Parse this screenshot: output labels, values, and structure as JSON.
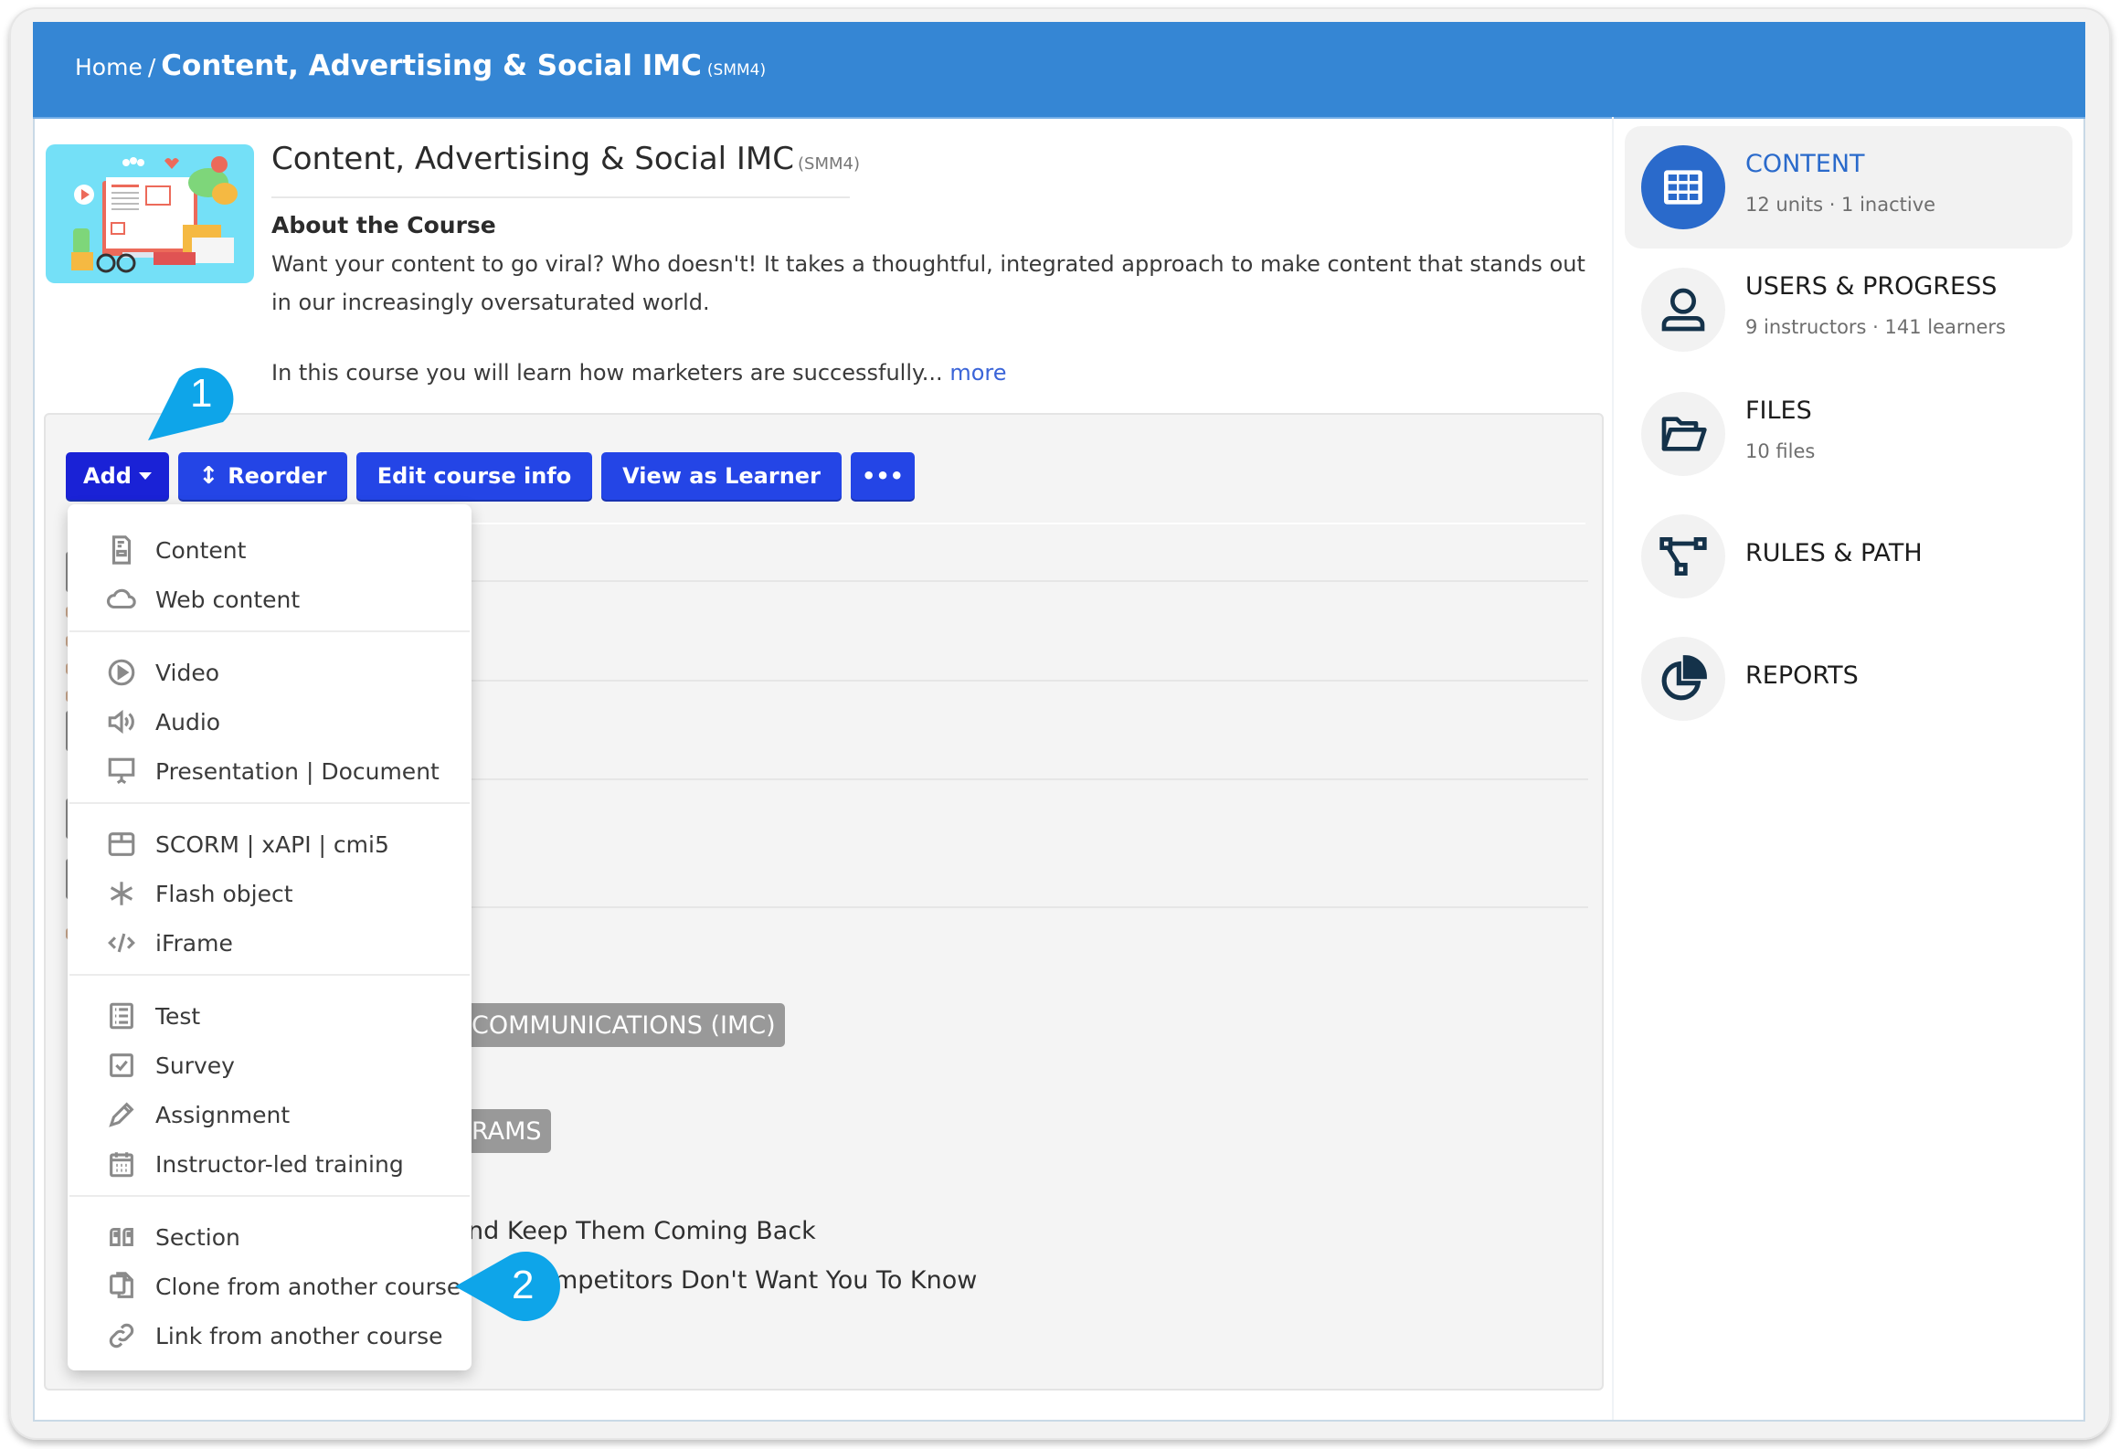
{
  "breadcrumb": {
    "home": "Home",
    "separator": "/",
    "course_title": "Content, Advertising & Social IMC",
    "course_code": "(SMM4)"
  },
  "course": {
    "title": "Content, Advertising & Social IMC",
    "code": "(SMM4)",
    "about_heading": "About the Course",
    "description_1": "Want your content to go viral? Who doesn't! It takes a thoughtful, integrated approach to make content that stands out in our increasingly oversaturated world.",
    "description_2": "In this course you will learn how marketers are successfully...",
    "more_link": "more"
  },
  "toolbar": {
    "add_label": "Add",
    "reorder_label": "Reorder",
    "edit_label": "Edit course info",
    "view_label": "View as Learner",
    "more_label": "•••"
  },
  "add_menu": {
    "groups": [
      [
        {
          "label": "Content",
          "icon": "document-icon"
        },
        {
          "label": "Web content",
          "icon": "cloud-icon"
        }
      ],
      [
        {
          "label": "Video",
          "icon": "play-circle-icon"
        },
        {
          "label": "Audio",
          "icon": "speaker-icon"
        },
        {
          "label": "Presentation | Document",
          "icon": "presentation-icon"
        }
      ],
      [
        {
          "label": "SCORM | xAPI | cmi5",
          "icon": "package-icon"
        },
        {
          "label": "Flash object",
          "icon": "asterisk-icon"
        },
        {
          "label": "iFrame",
          "icon": "code-icon"
        }
      ],
      [
        {
          "label": "Test",
          "icon": "checklist-icon"
        },
        {
          "label": "Survey",
          "icon": "checkbox-icon"
        },
        {
          "label": "Assignment",
          "icon": "pencil-icon"
        },
        {
          "label": "Instructor-led training",
          "icon": "calendar-icon"
        }
      ],
      [
        {
          "label": "Section",
          "icon": "quote-icon"
        },
        {
          "label": "Clone from another course",
          "icon": "clone-icon"
        },
        {
          "label": "Link from another course",
          "icon": "link-icon"
        }
      ]
    ]
  },
  "background_units": {
    "badge_1": "COMMUNICATIONS (IMC)",
    "badge_2": "RAMS",
    "unit_1": "nd Keep Them Coming Back",
    "unit_2": "mpetitors Don't Want You To Know"
  },
  "sidebar": {
    "items": [
      {
        "label": "CONTENT",
        "sub": "12 units · 1 inactive",
        "icon": "grid-icon",
        "active": true
      },
      {
        "label": "USERS & PROGRESS",
        "sub": "9 instructors · 141 learners",
        "icon": "user-icon",
        "active": false
      },
      {
        "label": "FILES",
        "sub": "10 files",
        "icon": "folder-open-icon",
        "active": false
      },
      {
        "label": "RULES & PATH",
        "sub": "",
        "icon": "flow-icon",
        "active": false
      },
      {
        "label": "REPORTS",
        "sub": "",
        "icon": "pie-chart-icon",
        "active": false
      }
    ]
  },
  "callouts": {
    "one": "1",
    "two": "2"
  },
  "colors": {
    "header": "#3586d4",
    "button": "#2445e6",
    "button_active": "#1a22d6",
    "sidebar_active": "#2a6acb",
    "callout": "#0ea5e9",
    "link": "#3a64d8"
  }
}
